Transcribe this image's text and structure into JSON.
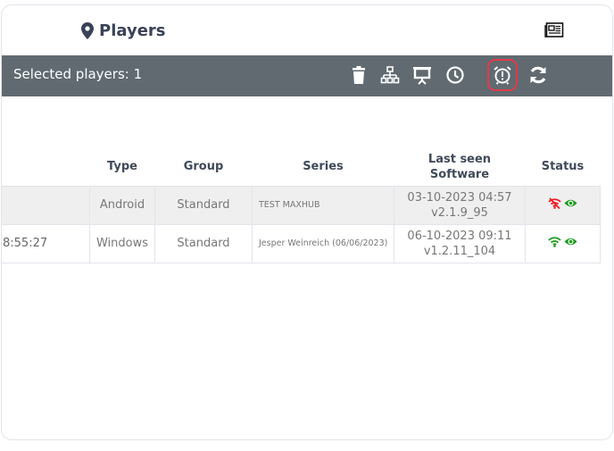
{
  "header": {
    "title": "Players",
    "title_icon": "map-marker-icon",
    "right_icon": "newspaper-icon"
  },
  "toolbar": {
    "selected_text": "Selected players: 1",
    "icons": [
      "trash-icon",
      "sitemap-icon",
      "presentation-icon",
      "clock-icon",
      "alarm-clock-icon",
      "refresh-icon"
    ],
    "highlighted": "alarm-clock-icon",
    "highlight_color": "#e23a4a",
    "background": "#616a71"
  },
  "table": {
    "columns": [
      "",
      "Type",
      "Group",
      "Series",
      "Last seen\nSoftware",
      "Status"
    ],
    "col_type": "Type",
    "col_group": "Group",
    "col_series": "Series",
    "col_lastseen_line1": "Last seen",
    "col_lastseen_line2": "Software",
    "col_status": "Status",
    "rows": [
      {
        "first": "",
        "type": "Android",
        "group": "Standard",
        "series": "TEST MAXHUB",
        "last_seen": "03-10-2023 04:57",
        "software": "v2.1.9_95",
        "connection": "offline",
        "visible": true
      },
      {
        "first": "8:55:27",
        "type": "Windows",
        "group": "Standard",
        "series": "Jesper Weinreich (06/06/2023)",
        "last_seen": "06-10-2023 09:11",
        "software": "v1.2.11_104",
        "connection": "online",
        "visible": true
      }
    ]
  },
  "colors": {
    "online": "#1a9a1a",
    "offline": "#ee1c25",
    "title": "#3a4257"
  }
}
